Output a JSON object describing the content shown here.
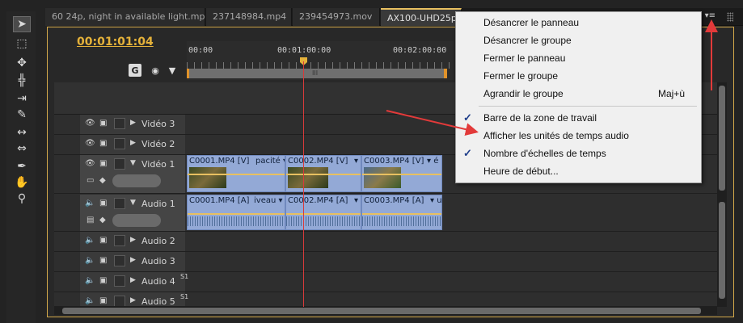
{
  "tabs": [
    {
      "label": "60 24p, night in available light.mp4"
    },
    {
      "label": "237148984.mp4"
    },
    {
      "label": "239454973.mov"
    },
    {
      "label": "AX100-UHD25p"
    }
  ],
  "timeline": {
    "timecode": "00:01:01:04",
    "ruler": [
      "00:00",
      "00:01:00:00",
      "00:02:00:00"
    ],
    "workbar_grip": "III",
    "video_tracks": [
      {
        "name": "Vidéo 3"
      },
      {
        "name": "Vidéo 2"
      },
      {
        "name": "Vidéo 1"
      }
    ],
    "audio_tracks": [
      {
        "name": "Audio 1"
      },
      {
        "name": "Audio 2"
      },
      {
        "name": "Audio 3"
      },
      {
        "name": "Audio 4",
        "sup": "S1"
      },
      {
        "name": "Audio 5",
        "sup": "S1"
      }
    ],
    "video_clips": [
      {
        "label": "C0001.MP4 [V]",
        "tail": "pacité ▾"
      },
      {
        "label": "C0002.MP4 [V]",
        "tail": "▾"
      },
      {
        "label": "C0003.MP4 [V]",
        "tail": "▾ é"
      }
    ],
    "audio_clips": [
      {
        "label": "C0001.MP4 [A]",
        "tail": "iveau ▾"
      },
      {
        "label": "C0002.MP4 [A]",
        "tail": "▾"
      },
      {
        "label": "C0003.MP4 [A]",
        "tail": "▾ u"
      }
    ]
  },
  "menu": {
    "items": [
      {
        "label": "Désancrer le panneau",
        "shortcut": "",
        "checked": false
      },
      {
        "label": "Désancrer le groupe",
        "shortcut": "",
        "checked": false
      },
      {
        "label": "Fermer le panneau",
        "shortcut": "",
        "checked": false
      },
      {
        "label": "Fermer le groupe",
        "shortcut": "",
        "checked": false
      },
      {
        "label": "Agrandir le groupe",
        "shortcut": "Maj+ù",
        "checked": false
      },
      {
        "label": "Barre de la zone de travail",
        "shortcut": "",
        "checked": true
      },
      {
        "label": "Afficher les unités de temps audio",
        "shortcut": "",
        "checked": false
      },
      {
        "label": "Nombre d'échelles de temps",
        "shortcut": "",
        "checked": true
      },
      {
        "label": "Heure de début...",
        "shortcut": "",
        "checked": false
      }
    ],
    "check_glyph": "✓"
  },
  "icons": {
    "toolbar": [
      "selection-arrow-icon",
      "track-select-icon",
      "ripple-edit-icon",
      "rolling-edit-icon",
      "rate-stretch-icon",
      "razor-icon",
      "slip-icon",
      "slide-icon",
      "pen-icon",
      "hand-icon",
      "zoom-icon"
    ],
    "tab_menu": "▾≡"
  },
  "colors": {
    "timecode": "#e5b23a",
    "panel_border": "#d4a94a",
    "clip_fill": "#93a9d6",
    "playhead": "#d83a3a",
    "annotation_arrow": "#e23a3a"
  }
}
